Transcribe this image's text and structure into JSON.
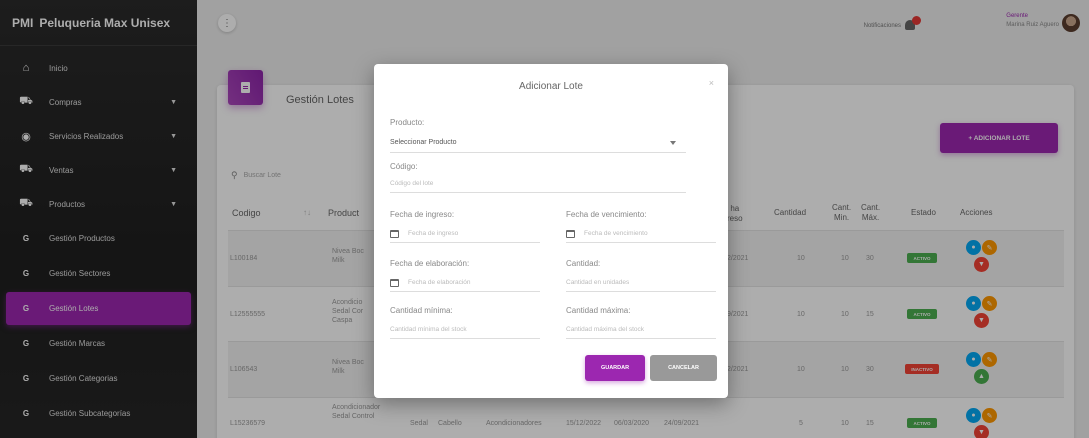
{
  "brand": {
    "abbr": "PMI",
    "name": "Peluqueria Max Unisex"
  },
  "sidebar": {
    "items": [
      {
        "label": "Inicio",
        "icon": "home-icon",
        "glyph": "⌂",
        "chevron": false
      },
      {
        "label": "Compras",
        "icon": "cart-icon",
        "glyph": "⛟",
        "chevron": true
      },
      {
        "label": "Servicios Realizados",
        "icon": "eye-icon",
        "glyph": "◉",
        "chevron": true
      },
      {
        "label": "Ventas",
        "icon": "cart-icon",
        "glyph": "⛟",
        "chevron": true
      },
      {
        "label": "Productos",
        "icon": "cart-icon",
        "glyph": "⛟",
        "chevron": true
      },
      {
        "label": "Gestión Productos",
        "icon": "letter-g-icon",
        "glyph": "G",
        "chevron": false
      },
      {
        "label": "Gestión Sectores",
        "icon": "letter-g-icon",
        "glyph": "G",
        "chevron": false
      },
      {
        "label": "Gestión Lotes",
        "icon": "letter-g-icon",
        "glyph": "G",
        "chevron": false,
        "active": true
      },
      {
        "label": "Gestión Marcas",
        "icon": "letter-g-icon",
        "glyph": "G",
        "chevron": false
      },
      {
        "label": "Gestión Categorias",
        "icon": "letter-g-icon",
        "glyph": "G",
        "chevron": false
      },
      {
        "label": "Gestión Subcategorías",
        "icon": "letter-g-icon",
        "glyph": "G",
        "chevron": false
      }
    ],
    "active_color": "#9c27b0"
  },
  "topbar": {
    "notifications_label": "Notificaciones",
    "user_role": "Gerente",
    "user_name": "Marina Ruiz Aguero"
  },
  "page": {
    "title": "Gestión Lotes",
    "add_button": "+ ADICIONAR LOTE",
    "search_placeholder": "Buscar Lote"
  },
  "table": {
    "headers": {
      "codigo": "Codigo",
      "producto": "Product",
      "fecha_ingreso_a": "ha",
      "fecha_ingreso_b": "reso",
      "cantidad": "Cantidad",
      "cant_min_a": "Cant.",
      "cant_min_b": "Min.",
      "cant_max_a": "Cant.",
      "cant_max_b": "Máx.",
      "estado": "Estado",
      "acciones": "Acciones"
    },
    "rows": [
      {
        "codigo": "L100184",
        "producto": "Nivea Boc\nMilk",
        "fecha": "2/2021",
        "cantidad": "10",
        "min": "10",
        "max": "30",
        "estado": "ACTIVO"
      },
      {
        "codigo": "L12555555",
        "producto": "Acondicio\nSedal Cor\nCaspa",
        "fecha": "9/2021",
        "cantidad": "10",
        "min": "10",
        "max": "15",
        "estado": "ACTIVO"
      },
      {
        "codigo": "L106543",
        "producto": "Nivea Boc\nMilk",
        "fecha": "2/2021",
        "cantidad": "10",
        "min": "10",
        "max": "30",
        "estado": "INACTIVO"
      },
      {
        "codigo": "L15236579",
        "producto": "Acondicionador\nSedal Control",
        "marca": "Sedal",
        "sector": "Cabello",
        "categoria": "Acondicionadores",
        "f1": "15/12/2022",
        "f2": "06/03/2020",
        "fecha": "24/09/2021",
        "cantidad": "5",
        "min": "10",
        "max": "15",
        "estado": "ACTIVO"
      }
    ]
  },
  "modal": {
    "title": "Adicionar Lote",
    "close": "×",
    "producto_label": "Producto:",
    "producto_value": "Seleccionar Producto",
    "codigo_label": "Código:",
    "codigo_placeholder": "Código del lote",
    "fecha_ingreso_label": "Fecha de ingreso:",
    "fecha_ingreso_placeholder": "Fecha de ingreso",
    "fecha_venc_label": "Fecha de vencimiento:",
    "fecha_venc_placeholder": "Fecha de vencimiento",
    "fecha_elab_label": "Fecha de elaboración:",
    "fecha_elab_placeholder": "Fecha de elaboración",
    "cantidad_label": "Cantidad:",
    "cantidad_placeholder": "Cantidad en unidades",
    "cant_min_label": "Cantidad mínima:",
    "cant_min_placeholder": "Cantidad mínima del stock",
    "cant_max_label": "Cantidad máxima:",
    "cant_max_placeholder": "Cantidad máxima del stock",
    "save_label": "GUARDAR",
    "cancel_label": "CANCELAR"
  }
}
